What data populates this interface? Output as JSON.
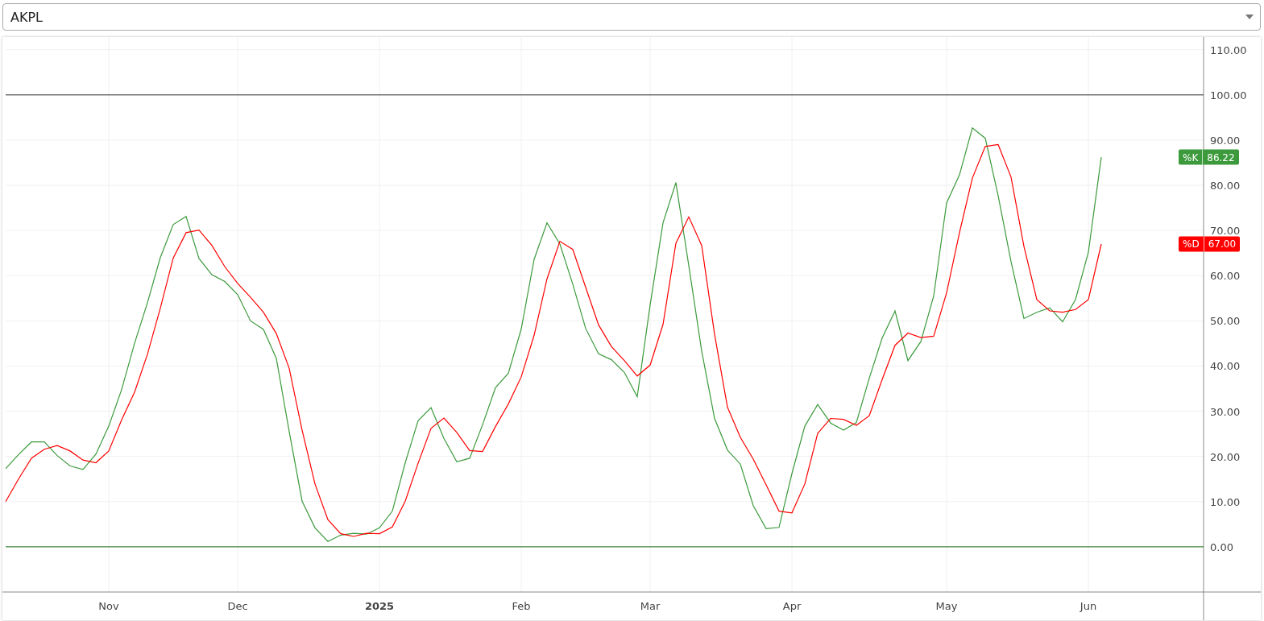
{
  "symbol_select": {
    "value": "AKPL"
  },
  "chart": {
    "chart_data": {
      "type": "line",
      "categories": [
        null,
        null,
        null,
        null,
        null,
        null,
        null,
        null,
        "Nov",
        null,
        null,
        null,
        null,
        null,
        null,
        null,
        null,
        null,
        "Dec",
        null,
        null,
        null,
        null,
        null,
        null,
        null,
        null,
        null,
        null,
        "2025",
        null,
        null,
        null,
        null,
        null,
        null,
        null,
        null,
        null,
        null,
        "Feb",
        null,
        null,
        null,
        null,
        null,
        null,
        null,
        null,
        null,
        "Mar",
        null,
        null,
        null,
        null,
        null,
        null,
        null,
        null,
        null,
        null,
        "Apr",
        null,
        null,
        null,
        null,
        null,
        null,
        null,
        null,
        null,
        null,
        null,
        "May",
        null,
        null,
        null,
        null,
        null,
        null,
        null,
        null,
        null,
        null,
        "Jun",
        null
      ],
      "series": [
        {
          "name": "%K",
          "color": "#3c9a3c",
          "values": [
            17.3,
            20.4,
            23.2,
            23.2,
            20.2,
            17.9,
            17.1,
            20.5,
            26.7,
            34.8,
            45,
            54,
            64,
            71.3,
            73.1,
            63.8,
            60.2,
            58.7,
            55.8,
            50,
            48.1,
            41.7,
            25.5,
            10.1,
            4.2,
            1.2,
            2.6,
            3,
            2.8,
            4.2,
            7.9,
            18.6,
            27.9,
            30.8,
            24,
            18.8,
            19.6,
            27,
            35.2,
            38.4,
            48.2,
            63.6,
            71.7,
            67,
            58.1,
            48.3,
            42.7,
            41.4,
            38.6,
            33.2,
            53.5,
            71.7,
            80.6,
            62.2,
            43.3,
            28.4,
            21.4,
            18.3,
            9.1,
            4,
            4.3,
            16.2,
            26.7,
            31.5,
            27.4,
            25.8,
            27.5,
            37.3,
            46.2,
            52.2,
            41.2,
            45.4,
            55.5,
            76.1,
            82.3,
            92.7,
            90.4,
            77.7,
            63.1,
            50.5,
            51.9,
            52.9,
            49.8,
            54.7,
            65.2,
            86.2
          ]
        },
        {
          "name": "%D",
          "color": "#ff0000",
          "values": [
            10,
            15,
            19.6,
            21.6,
            22.4,
            21.2,
            19.2,
            18.6,
            21.2,
            28.1,
            34.2,
            42.6,
            52.8,
            63.9,
            69.5,
            70.1,
            66.7,
            62,
            58.3,
            55.2,
            51.9,
            47.2,
            39.5,
            25.8,
            13.9,
            6,
            2.9,
            2.3,
            3,
            2.9,
            4.4,
            10.1,
            18.5,
            26.2,
            28.5,
            25.3,
            21.3,
            21.1,
            26.6,
            31.6,
            37.6,
            46.8,
            59.3,
            67.6,
            65.8,
            57.4,
            49.1,
            44.3,
            41.2,
            37.8,
            40.2,
            49.2,
            67.2,
            73,
            66.7,
            47,
            30.9,
            24.2,
            19.4,
            13.7,
            7.9,
            7.5,
            13.9,
            25.1,
            28.4,
            28.2,
            26.9,
            29,
            37,
            44.6,
            47.3,
            46.3,
            46.6,
            56.2,
            69.5,
            81.6,
            88.6,
            89,
            81.8,
            66.5,
            54.7,
            52.2,
            51.9,
            52.5,
            54.7,
            67
          ]
        }
      ],
      "ylim": [
        -10,
        112.8
      ],
      "yticks": [
        {
          "value": 0,
          "label": "0.00"
        },
        {
          "value": 10,
          "label": "10.00"
        },
        {
          "value": 20,
          "label": "20.00"
        },
        {
          "value": 30,
          "label": "30.00"
        },
        {
          "value": 40,
          "label": "40.00"
        },
        {
          "value": 50,
          "label": "50.00"
        },
        {
          "value": 60,
          "label": "60.00"
        },
        {
          "value": 70,
          "label": "70.00"
        },
        {
          "value": 80,
          "label": "80.00"
        },
        {
          "value": 90,
          "label": "90.00"
        },
        {
          "value": 100,
          "label": "100.00"
        },
        {
          "value": 110,
          "label": "110.00"
        }
      ],
      "grid": true,
      "ref_lines": [
        {
          "axis": "y",
          "value": 100
        },
        {
          "axis": "y",
          "value": 0
        }
      ]
    },
    "value_tags": [
      {
        "value": "86.22"
      },
      {
        "value": "67.00"
      }
    ]
  }
}
